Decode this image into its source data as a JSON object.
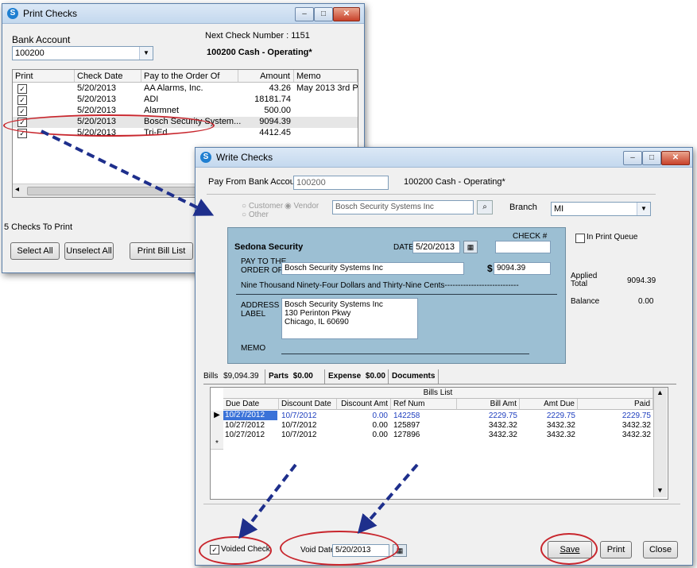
{
  "print_checks": {
    "title": "Print Checks",
    "bank_account_label": "Bank Account",
    "bank_account_value": "100200",
    "next_check_number": "Next Check Number : 1151",
    "account_name": "100200 Cash - Operating*",
    "columns": [
      "Print",
      "Check Date",
      "Pay to the Order Of",
      "Amount",
      "Memo"
    ],
    "rows": [
      {
        "date": "5/20/2013",
        "payee": "AA Alarms, Inc.",
        "amount": "43.26",
        "memo": "May 2013 3rd P"
      },
      {
        "date": "5/20/2013",
        "payee": "ADI",
        "amount": "18181.74",
        "memo": ""
      },
      {
        "date": "5/20/2013",
        "payee": "Alarmnet",
        "amount": "500.00",
        "memo": ""
      },
      {
        "date": "5/20/2013",
        "payee": "Bosch Security System...",
        "amount": "9094.39",
        "memo": ""
      },
      {
        "date": "5/20/2013",
        "payee": "Tri-Ed",
        "amount": "4412.45",
        "memo": ""
      }
    ],
    "checks_to_print": "5 Checks To Print",
    "select_all": "Select All",
    "unselect_all": "Unselect All",
    "print_bill_list": "Print Bill List"
  },
  "write_checks": {
    "title": "Write Checks",
    "pay_from_label": "Pay From Bank Account",
    "pay_from_value": "100200",
    "account_name": "100200 Cash - Operating*",
    "customer_label": "Customer",
    "vendor_label": "Vendor",
    "other_label": "Other",
    "vendor_value": "Bosch Security Systems Inc",
    "branch_label": "Branch",
    "branch_value": "MI",
    "company": "Sedona Security",
    "date_label": "DATE",
    "date_value": "5/20/2013",
    "check_no_label": "CHECK #",
    "pay_to_label_1": "PAY TO THE",
    "pay_to_label_2": "ORDER OF",
    "payee": "Bosch Security Systems Inc",
    "dollar_sign": "$",
    "amount": "9094.39",
    "amount_words": "Nine Thousand Ninety-Four Dollars and Thirty-Nine Cents----------------------------",
    "address_label_1": "ADDRESS",
    "address_label_2": "LABEL",
    "address_lines": [
      "Bosch Security Systems Inc",
      "130 Perinton Pkwy",
      "Chicago, IL  60690"
    ],
    "memo_label": "MEMO",
    "in_print_queue": "In Print Queue",
    "applied_label_1": "Applied",
    "applied_label_2": "Total",
    "applied_value": "9094.39",
    "balance_label": "Balance",
    "balance_value": "0.00",
    "tabs": [
      {
        "label": "Bills",
        "amount": "$9,094.39"
      },
      {
        "label": "Parts",
        "amount": "$0.00"
      },
      {
        "label": "Expense",
        "amount": "$0.00"
      },
      {
        "label": "Documents",
        "amount": ""
      }
    ],
    "bills_list_title": "Bills List",
    "bill_columns": [
      "Due Date",
      "Discount Date",
      "Discount Amt",
      "Ref Num",
      "Bill Amt",
      "Amt Due",
      "Paid"
    ],
    "bills": [
      {
        "due": "10/27/2012",
        "disc_date": "10/7/2012",
        "disc_amt": "0.00",
        "ref": "142258",
        "bill_amt": "2229.75",
        "amt_due": "2229.75",
        "paid": "2229.75"
      },
      {
        "due": "10/27/2012",
        "disc_date": "10/7/2012",
        "disc_amt": "0.00",
        "ref": "125897",
        "bill_amt": "3432.32",
        "amt_due": "3432.32",
        "paid": "3432.32"
      },
      {
        "due": "10/27/2012",
        "disc_date": "10/7/2012",
        "disc_amt": "0.00",
        "ref": "127896",
        "bill_amt": "3432.32",
        "amt_due": "3432.32",
        "paid": "3432.32"
      }
    ],
    "new_row_marker": "*",
    "current_row_marker": "▶",
    "voided_check": "Voided Check",
    "void_date_label": "Void Date",
    "void_date_value": "5/20/2013",
    "save": "Save",
    "print": "Print",
    "close": "Close"
  }
}
